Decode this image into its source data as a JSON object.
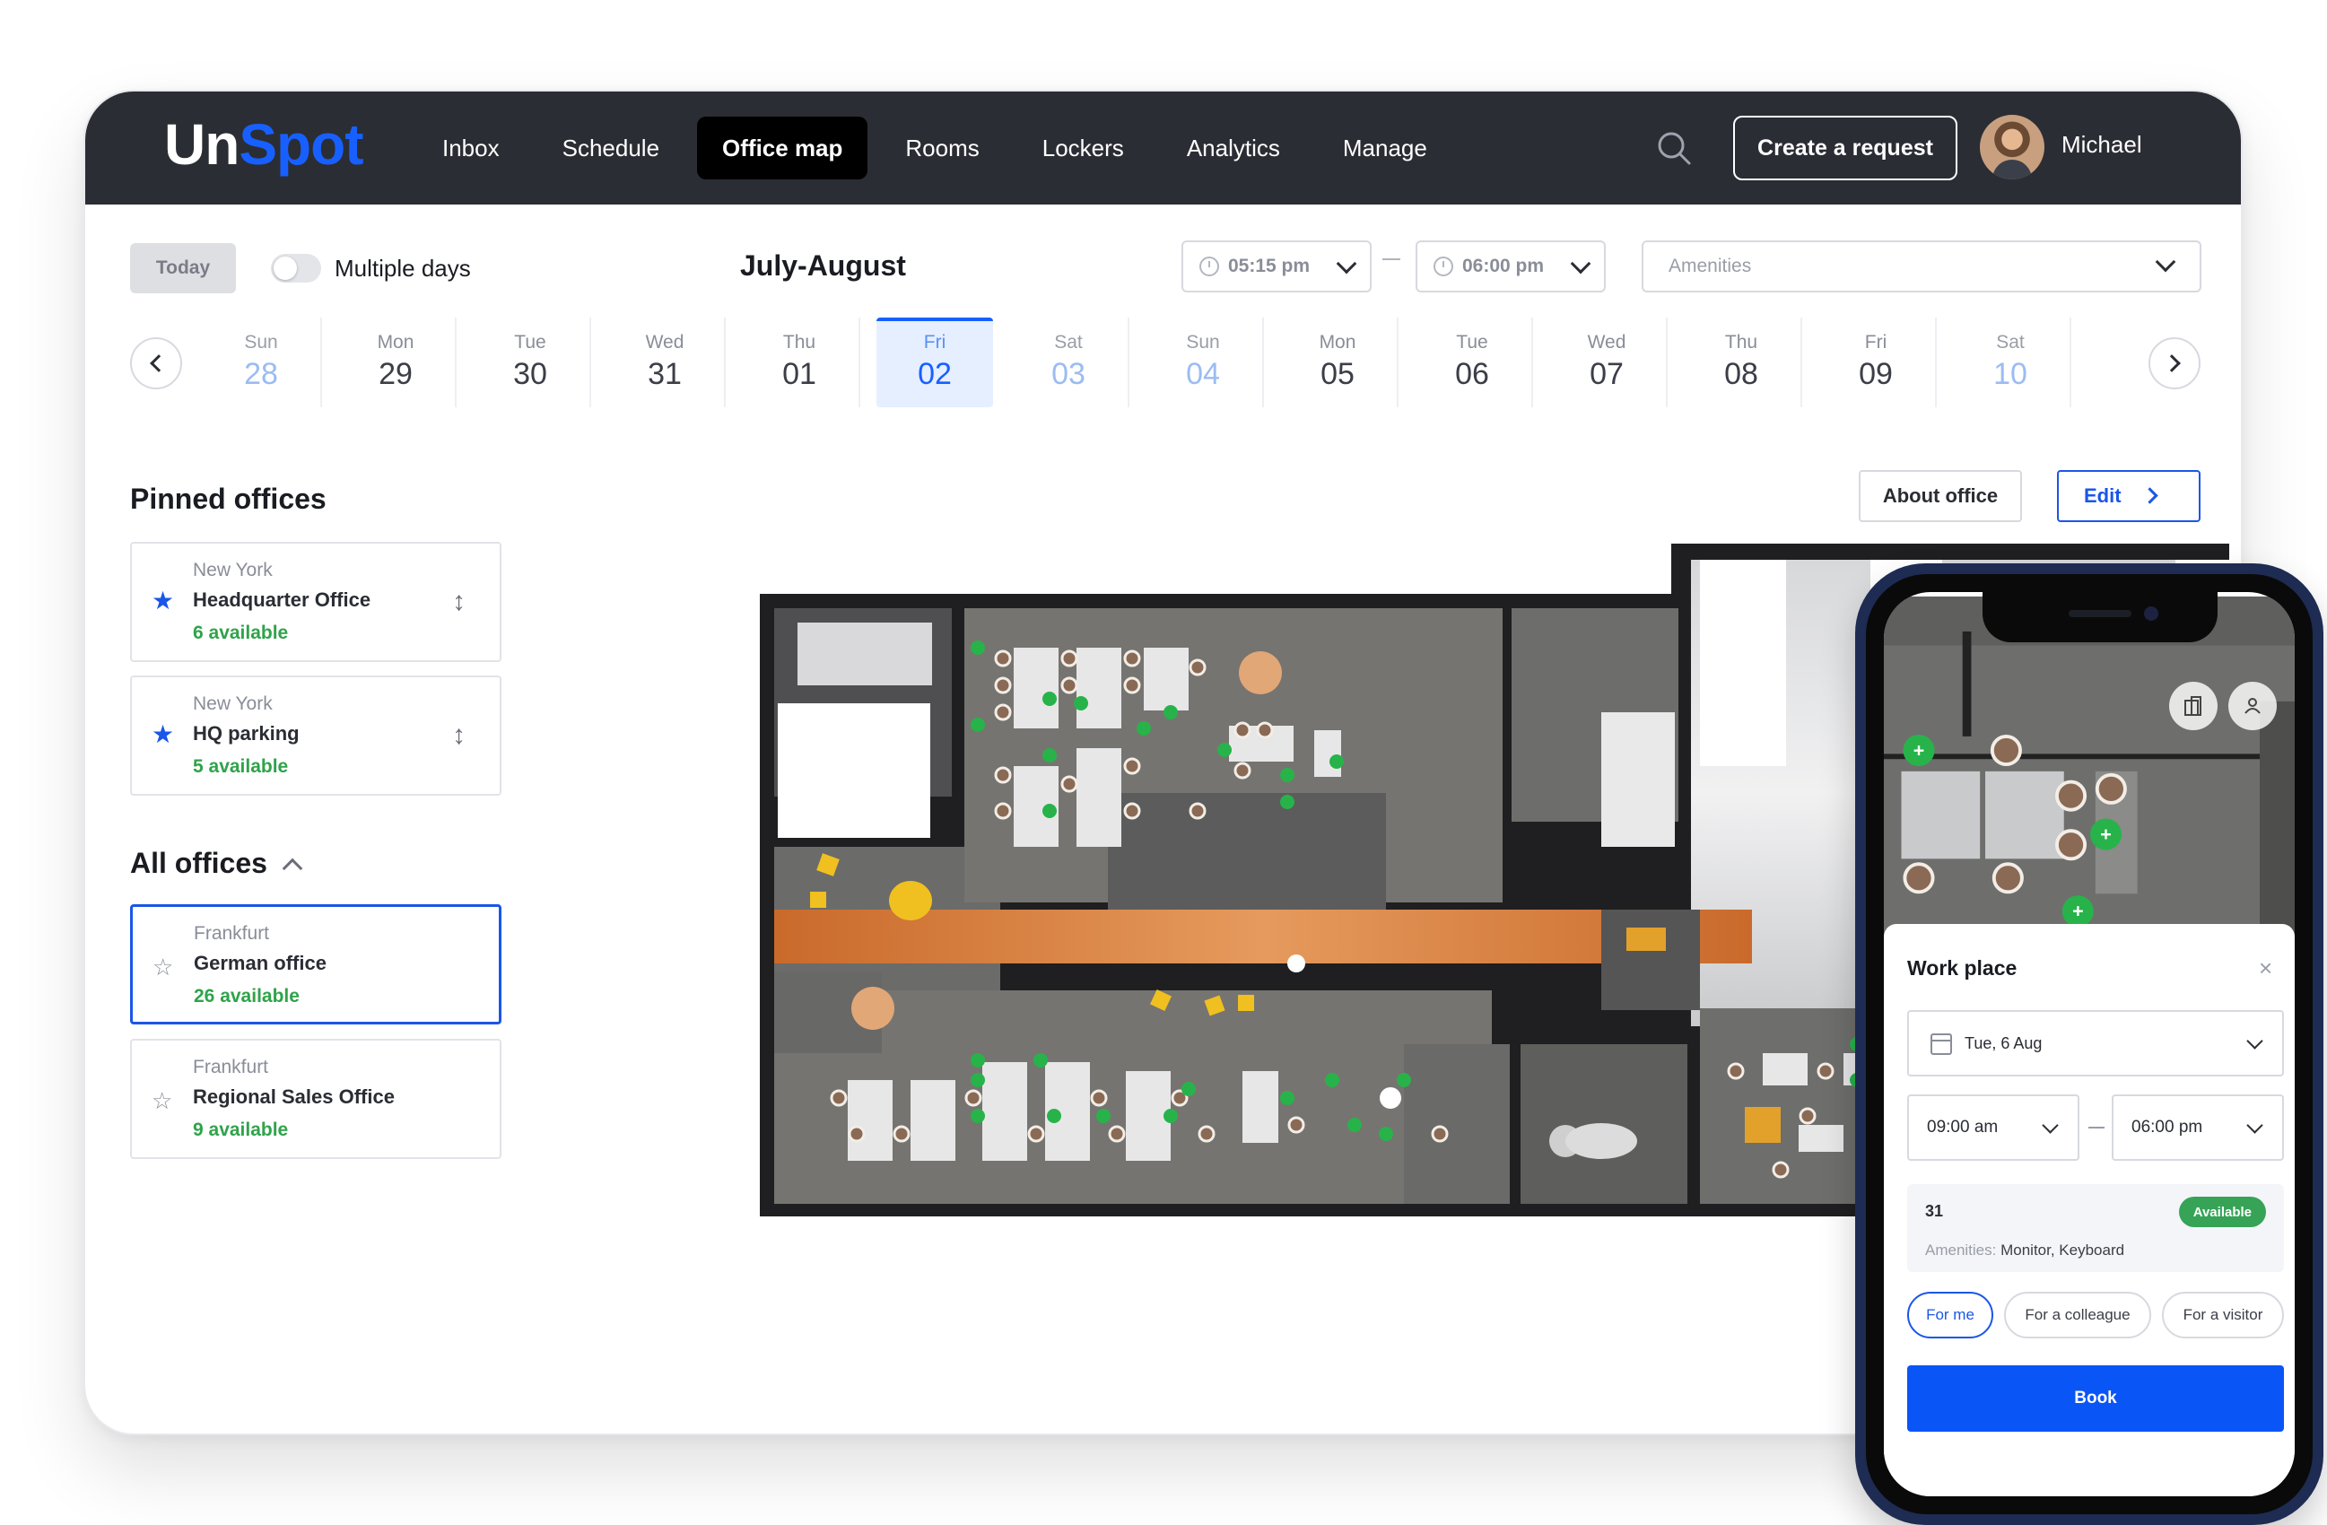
{
  "brand": {
    "logo_part1": "Un",
    "logo_part2": "Spot"
  },
  "nav": {
    "items": [
      "Inbox",
      "Schedule",
      "Office map",
      "Rooms",
      "Lockers",
      "Analytics",
      "Manage"
    ],
    "active": "Office map"
  },
  "header": {
    "create_label": "Create a request",
    "user_name": "Michael"
  },
  "filters": {
    "today_label": "Today",
    "multiple_days_label": "Multiple days",
    "multiple_days_on": false,
    "month_title": "July-August",
    "time_from": "05:15 pm",
    "time_to": "06:00 pm",
    "amenities_placeholder": "Amenities"
  },
  "dates": [
    {
      "day": "Sun",
      "num": "28",
      "weekend": true
    },
    {
      "day": "Mon",
      "num": "29",
      "weekend": false
    },
    {
      "day": "Tue",
      "num": "30",
      "weekend": false
    },
    {
      "day": "Wed",
      "num": "31",
      "weekend": false
    },
    {
      "day": "Thu",
      "num": "01",
      "weekend": false
    },
    {
      "day": "Fri",
      "num": "02",
      "weekend": false,
      "selected": true
    },
    {
      "day": "Sat",
      "num": "03",
      "weekend": true
    },
    {
      "day": "Sun",
      "num": "04",
      "weekend": true
    },
    {
      "day": "Mon",
      "num": "05",
      "weekend": false
    },
    {
      "day": "Tue",
      "num": "06",
      "weekend": false
    },
    {
      "day": "Wed",
      "num": "07",
      "weekend": false
    },
    {
      "day": "Thu",
      "num": "08",
      "weekend": false
    },
    {
      "day": "Fri",
      "num": "09",
      "weekend": false
    },
    {
      "day": "Sat",
      "num": "10",
      "weekend": true
    }
  ],
  "pinned": {
    "title": "Pinned offices",
    "offices": [
      {
        "city": "New York",
        "name": "Headquarter Office",
        "available": "6 available"
      },
      {
        "city": "New York",
        "name": "HQ parking",
        "available": "5 available"
      }
    ]
  },
  "all_offices": {
    "title": "All offices",
    "offices": [
      {
        "city": "Frankfurt",
        "name": "German office",
        "available": "26 available",
        "selected": true
      },
      {
        "city": "Frankfurt",
        "name": "Regional Sales Office",
        "available": "9 available"
      }
    ]
  },
  "map_actions": {
    "about_label": "About office",
    "edit_label": "Edit"
  },
  "mobile": {
    "panel_title": "Work place",
    "date_value": "Tue, 6 Aug",
    "time_from": "09:00 am",
    "time_to": "06:00 pm",
    "seat_number": "31",
    "seat_status": "Available",
    "amenities_label": "Amenities:",
    "amenities_value": "Monitor, Keyboard",
    "chips": [
      "For me",
      "For a colleague",
      "For a visitor"
    ],
    "chip_active": "For me",
    "book_label": "Book"
  },
  "colors": {
    "brand_blue": "#1760ff",
    "header_bg": "#2b2d34",
    "available_green": "#2fa34a",
    "accent_orange": "#e0772f"
  }
}
